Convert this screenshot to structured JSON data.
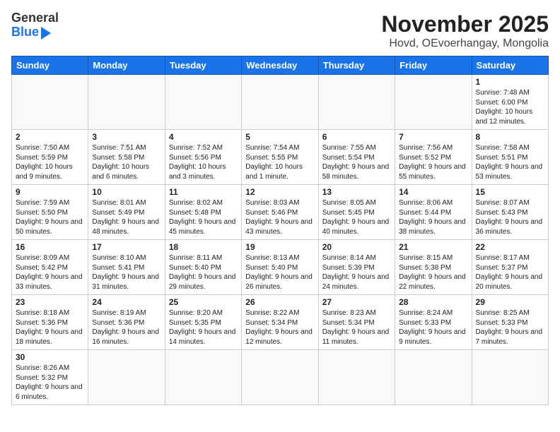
{
  "header": {
    "logo_line1": "General",
    "logo_line2": "Blue",
    "title": "November 2025",
    "subtitle": "Hovd, OEvoerhangay, Mongolia"
  },
  "weekdays": [
    "Sunday",
    "Monday",
    "Tuesday",
    "Wednesday",
    "Thursday",
    "Friday",
    "Saturday"
  ],
  "weeks": [
    [
      {
        "date": "",
        "info": ""
      },
      {
        "date": "",
        "info": ""
      },
      {
        "date": "",
        "info": ""
      },
      {
        "date": "",
        "info": ""
      },
      {
        "date": "",
        "info": ""
      },
      {
        "date": "",
        "info": ""
      },
      {
        "date": "1",
        "info": "Sunrise: 7:48 AM\nSunset: 6:00 PM\nDaylight: 10 hours and 12 minutes."
      }
    ],
    [
      {
        "date": "2",
        "info": "Sunrise: 7:50 AM\nSunset: 5:59 PM\nDaylight: 10 hours and 9 minutes."
      },
      {
        "date": "3",
        "info": "Sunrise: 7:51 AM\nSunset: 5:58 PM\nDaylight: 10 hours and 6 minutes."
      },
      {
        "date": "4",
        "info": "Sunrise: 7:52 AM\nSunset: 5:56 PM\nDaylight: 10 hours and 3 minutes."
      },
      {
        "date": "5",
        "info": "Sunrise: 7:54 AM\nSunset: 5:55 PM\nDaylight: 10 hours and 1 minute."
      },
      {
        "date": "6",
        "info": "Sunrise: 7:55 AM\nSunset: 5:54 PM\nDaylight: 9 hours and 58 minutes."
      },
      {
        "date": "7",
        "info": "Sunrise: 7:56 AM\nSunset: 5:52 PM\nDaylight: 9 hours and 55 minutes."
      },
      {
        "date": "8",
        "info": "Sunrise: 7:58 AM\nSunset: 5:51 PM\nDaylight: 9 hours and 53 minutes."
      }
    ],
    [
      {
        "date": "9",
        "info": "Sunrise: 7:59 AM\nSunset: 5:50 PM\nDaylight: 9 hours and 50 minutes."
      },
      {
        "date": "10",
        "info": "Sunrise: 8:01 AM\nSunset: 5:49 PM\nDaylight: 9 hours and 48 minutes."
      },
      {
        "date": "11",
        "info": "Sunrise: 8:02 AM\nSunset: 5:48 PM\nDaylight: 9 hours and 45 minutes."
      },
      {
        "date": "12",
        "info": "Sunrise: 8:03 AM\nSunset: 5:46 PM\nDaylight: 9 hours and 43 minutes."
      },
      {
        "date": "13",
        "info": "Sunrise: 8:05 AM\nSunset: 5:45 PM\nDaylight: 9 hours and 40 minutes."
      },
      {
        "date": "14",
        "info": "Sunrise: 8:06 AM\nSunset: 5:44 PM\nDaylight: 9 hours and 38 minutes."
      },
      {
        "date": "15",
        "info": "Sunrise: 8:07 AM\nSunset: 5:43 PM\nDaylight: 9 hours and 36 minutes."
      }
    ],
    [
      {
        "date": "16",
        "info": "Sunrise: 8:09 AM\nSunset: 5:42 PM\nDaylight: 9 hours and 33 minutes."
      },
      {
        "date": "17",
        "info": "Sunrise: 8:10 AM\nSunset: 5:41 PM\nDaylight: 9 hours and 31 minutes."
      },
      {
        "date": "18",
        "info": "Sunrise: 8:11 AM\nSunset: 5:40 PM\nDaylight: 9 hours and 29 minutes."
      },
      {
        "date": "19",
        "info": "Sunrise: 8:13 AM\nSunset: 5:40 PM\nDaylight: 9 hours and 26 minutes."
      },
      {
        "date": "20",
        "info": "Sunrise: 8:14 AM\nSunset: 5:39 PM\nDaylight: 9 hours and 24 minutes."
      },
      {
        "date": "21",
        "info": "Sunrise: 8:15 AM\nSunset: 5:38 PM\nDaylight: 9 hours and 22 minutes."
      },
      {
        "date": "22",
        "info": "Sunrise: 8:17 AM\nSunset: 5:37 PM\nDaylight: 9 hours and 20 minutes."
      }
    ],
    [
      {
        "date": "23",
        "info": "Sunrise: 8:18 AM\nSunset: 5:36 PM\nDaylight: 9 hours and 18 minutes."
      },
      {
        "date": "24",
        "info": "Sunrise: 8:19 AM\nSunset: 5:36 PM\nDaylight: 9 hours and 16 minutes."
      },
      {
        "date": "25",
        "info": "Sunrise: 8:20 AM\nSunset: 5:35 PM\nDaylight: 9 hours and 14 minutes."
      },
      {
        "date": "26",
        "info": "Sunrise: 8:22 AM\nSunset: 5:34 PM\nDaylight: 9 hours and 12 minutes."
      },
      {
        "date": "27",
        "info": "Sunrise: 8:23 AM\nSunset: 5:34 PM\nDaylight: 9 hours and 11 minutes."
      },
      {
        "date": "28",
        "info": "Sunrise: 8:24 AM\nSunset: 5:33 PM\nDaylight: 9 hours and 9 minutes."
      },
      {
        "date": "29",
        "info": "Sunrise: 8:25 AM\nSunset: 5:33 PM\nDaylight: 9 hours and 7 minutes."
      }
    ],
    [
      {
        "date": "30",
        "info": "Sunrise: 8:26 AM\nSunset: 5:32 PM\nDaylight: 9 hours and 6 minutes."
      },
      {
        "date": "",
        "info": ""
      },
      {
        "date": "",
        "info": ""
      },
      {
        "date": "",
        "info": ""
      },
      {
        "date": "",
        "info": ""
      },
      {
        "date": "",
        "info": ""
      },
      {
        "date": "",
        "info": ""
      }
    ]
  ]
}
